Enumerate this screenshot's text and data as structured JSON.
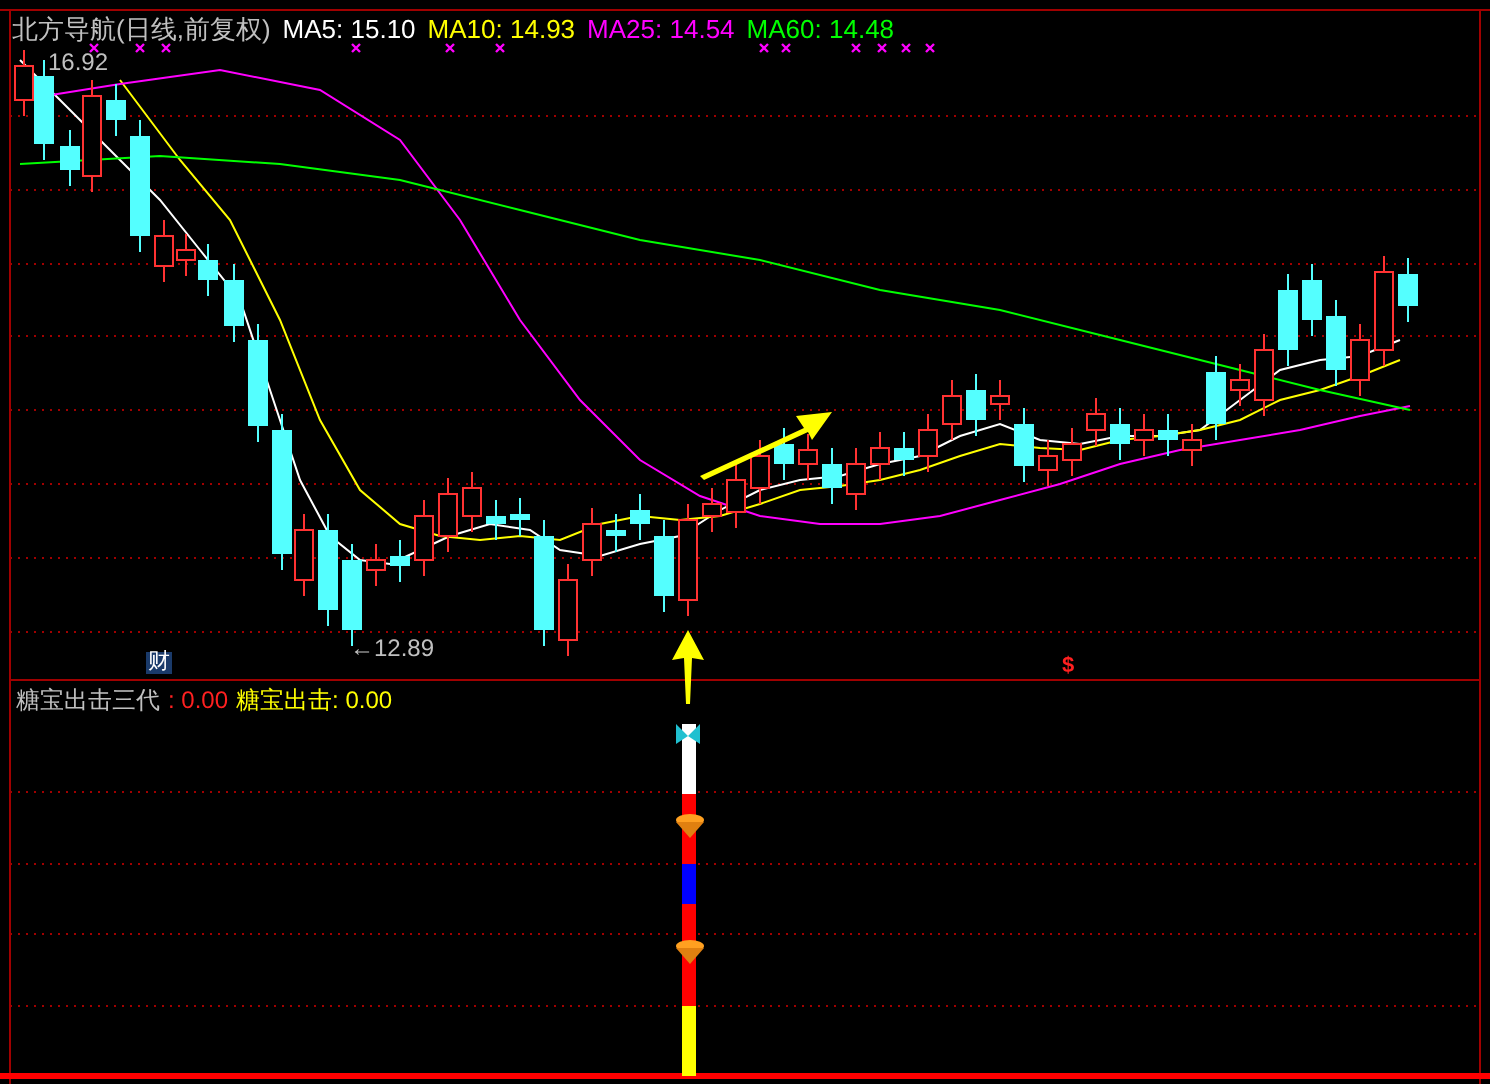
{
  "title": "北方导航(日线,前复权)",
  "moving_averages": [
    {
      "label": "MA5:",
      "value": "15.10",
      "color": "#ffffff"
    },
    {
      "label": "MA10:",
      "value": "14.93",
      "color": "#ffff00"
    },
    {
      "label": "MA25:",
      "value": "14.54",
      "color": "#ff00ff"
    },
    {
      "label": "MA60:",
      "value": "14.48",
      "color": "#00ff00"
    }
  ],
  "price_labels": {
    "high": "16.92",
    "low": "←12.89"
  },
  "badge": "财",
  "signal_mark": "$",
  "indicator": {
    "name": "糖宝出击三代",
    "value": ": 0.00",
    "series": [
      {
        "label": "糖宝出击: 0.00",
        "color": "#ffff00"
      }
    ]
  }
}
